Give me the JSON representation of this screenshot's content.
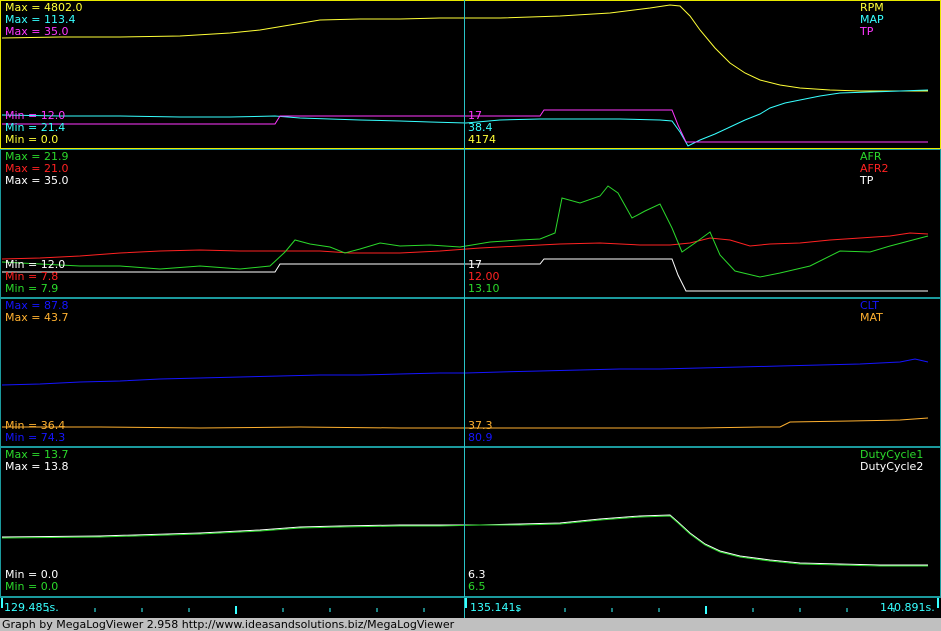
{
  "colors": {
    "yellow": "#ffff37",
    "cyan": "#37ffff",
    "magenta": "#ff37ff",
    "green": "#2bd82b",
    "red": "#ff2222",
    "white": "#ffffff",
    "blue": "#1515ff",
    "orange": "#ffb130",
    "cursor": "#29c2c6"
  },
  "panels": [
    {
      "max": [
        {
          "text": "Max = 4802.0",
          "color": "yellow"
        },
        {
          "text": "Max = 113.4",
          "color": "cyan"
        },
        {
          "text": "Max = 35.0",
          "color": "magenta"
        }
      ],
      "min": [
        {
          "text": "Min = 12.0",
          "color": "magenta"
        },
        {
          "text": "Min = 21.4",
          "color": "cyan"
        },
        {
          "text": "Min = 0.0",
          "color": "yellow"
        }
      ],
      "legend": [
        {
          "text": "RPM",
          "color": "yellow"
        },
        {
          "text": "MAP",
          "color": "cyan"
        },
        {
          "text": "TP",
          "color": "magenta"
        }
      ],
      "cursor_values": [
        {
          "text": "17",
          "color": "magenta"
        },
        {
          "text": "38.4",
          "color": "cyan"
        },
        {
          "text": "4174",
          "color": "yellow"
        }
      ]
    },
    {
      "max": [
        {
          "text": "Max = 21.9",
          "color": "green"
        },
        {
          "text": "Max = 21.0",
          "color": "red"
        },
        {
          "text": "Max = 35.0",
          "color": "white"
        }
      ],
      "min": [
        {
          "text": "Min = 12.0",
          "color": "white"
        },
        {
          "text": "Min = 7.8",
          "color": "red"
        },
        {
          "text": "Min = 7.9",
          "color": "green"
        }
      ],
      "legend": [
        {
          "text": "AFR",
          "color": "green"
        },
        {
          "text": "AFR2",
          "color": "red"
        },
        {
          "text": "TP",
          "color": "white"
        }
      ],
      "cursor_values": [
        {
          "text": "17",
          "color": "white"
        },
        {
          "text": "12.00",
          "color": "red"
        },
        {
          "text": "13.10",
          "color": "green"
        }
      ]
    },
    {
      "max": [
        {
          "text": "Max = 87.8",
          "color": "blue"
        },
        {
          "text": "Max = 43.7",
          "color": "orange"
        }
      ],
      "min": [
        {
          "text": "Min = 36.4",
          "color": "orange"
        },
        {
          "text": "Min = 74.3",
          "color": "blue"
        }
      ],
      "legend": [
        {
          "text": "CLT",
          "color": "blue"
        },
        {
          "text": "MAT",
          "color": "orange"
        }
      ],
      "cursor_values": [
        {
          "text": "37.3",
          "color": "orange"
        },
        {
          "text": "80.9",
          "color": "blue"
        }
      ]
    },
    {
      "max": [
        {
          "text": "Max = 13.7",
          "color": "green"
        },
        {
          "text": "Max = 13.8",
          "color": "white"
        }
      ],
      "min": [
        {
          "text": "Min = 0.0",
          "color": "white"
        },
        {
          "text": "Min = 0.0",
          "color": "green"
        }
      ],
      "legend": [
        {
          "text": "DutyCycle1",
          "color": "green"
        },
        {
          "text": "DutyCycle2",
          "color": "white"
        }
      ],
      "cursor_values": [
        {
          "text": "6.3",
          "color": "white"
        },
        {
          "text": "6.5",
          "color": "green"
        }
      ]
    }
  ],
  "time_axis": {
    "start": "129.485s.",
    "cursor": "135.141s",
    "end": "140.891s."
  },
  "status_bar": "Graph by MegaLogViewer 2.958 http://www.ideasandsolutions.biz/MegaLogViewer"
}
